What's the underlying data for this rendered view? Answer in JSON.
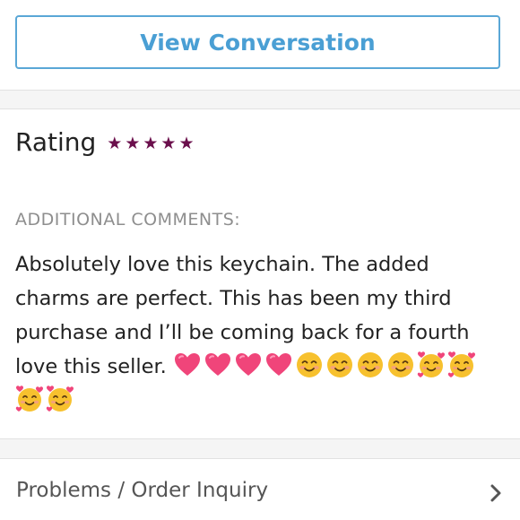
{
  "conversation": {
    "view_button_label": "View Conversation"
  },
  "rating": {
    "label": "Rating",
    "stars": 5,
    "star_glyph": "★",
    "star_color": "#6b0f4c"
  },
  "comments": {
    "heading": "ADDITIONAL COMMENTS:",
    "text": "Absolutely love this keychain. The added charms are perfect. This has been my third purchase and I’ll be coming back for a fourth love this seller.",
    "emojis": [
      "heart-icon",
      "heart-icon",
      "heart-icon",
      "heart-icon",
      "smiling-face-icon",
      "smiling-face-icon",
      "smiling-face-icon",
      "smiling-face-icon",
      "smiling-face-with-hearts-icon",
      "smiling-face-with-hearts-icon",
      "smiling-face-with-hearts-icon",
      "smiling-face-with-hearts-icon"
    ]
  },
  "inquiry": {
    "label": "Problems / Order Inquiry",
    "chevron_icon": "chevron-right-icon"
  },
  "colors": {
    "accent": "#4a9fd4",
    "heart": "#f0457a",
    "smile": "#f7c12e",
    "blush": "#f59a8a"
  }
}
